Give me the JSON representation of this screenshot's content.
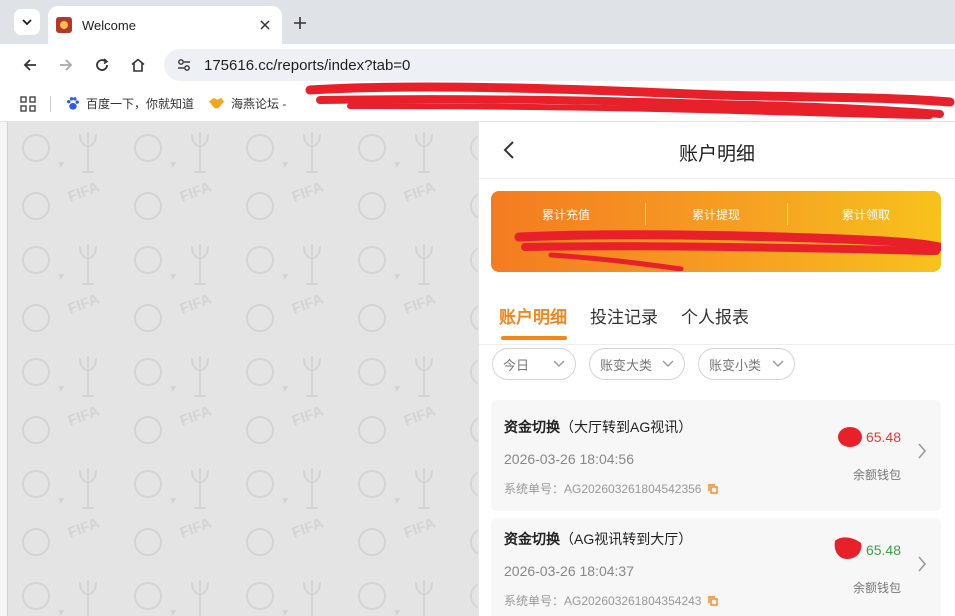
{
  "browser": {
    "tab_title": "Welcome",
    "url": "175616.cc/reports/index?tab=0",
    "bookmarks": [
      {
        "label": "百度一下，你就知道",
        "icon": "baidu-paw-icon"
      },
      {
        "label": "海燕论坛 -",
        "icon": "handshake-icon"
      }
    ]
  },
  "panel": {
    "title": "账户明细",
    "summary": {
      "labels": [
        "累计充值",
        "累计提现",
        "累计领取"
      ]
    },
    "tabs": [
      "账户明细",
      "投注记录",
      "个人报表"
    ],
    "active_tab": 0,
    "filters": [
      "今日",
      "账变大类",
      "账变小类"
    ],
    "records": [
      {
        "type": "资金切换",
        "detail": "（大厅转到AG视讯）",
        "time": "2026-03-26 18:04:56",
        "order": "系统单号：AG202603261804542356",
        "amount": "65.48",
        "amount_color": "#e53935",
        "wallet": "余额钱包"
      },
      {
        "type": "资金切换",
        "detail": "（AG视讯转到大厅）",
        "time": "2026-03-26 18:04:37",
        "order": "系统单号：AG202603261804354243",
        "amount": "65.48",
        "amount_color": "#43a047",
        "wallet": "余额钱包"
      }
    ]
  },
  "colors": {
    "accent": "#f4861d",
    "redaction": "#e8202a"
  }
}
